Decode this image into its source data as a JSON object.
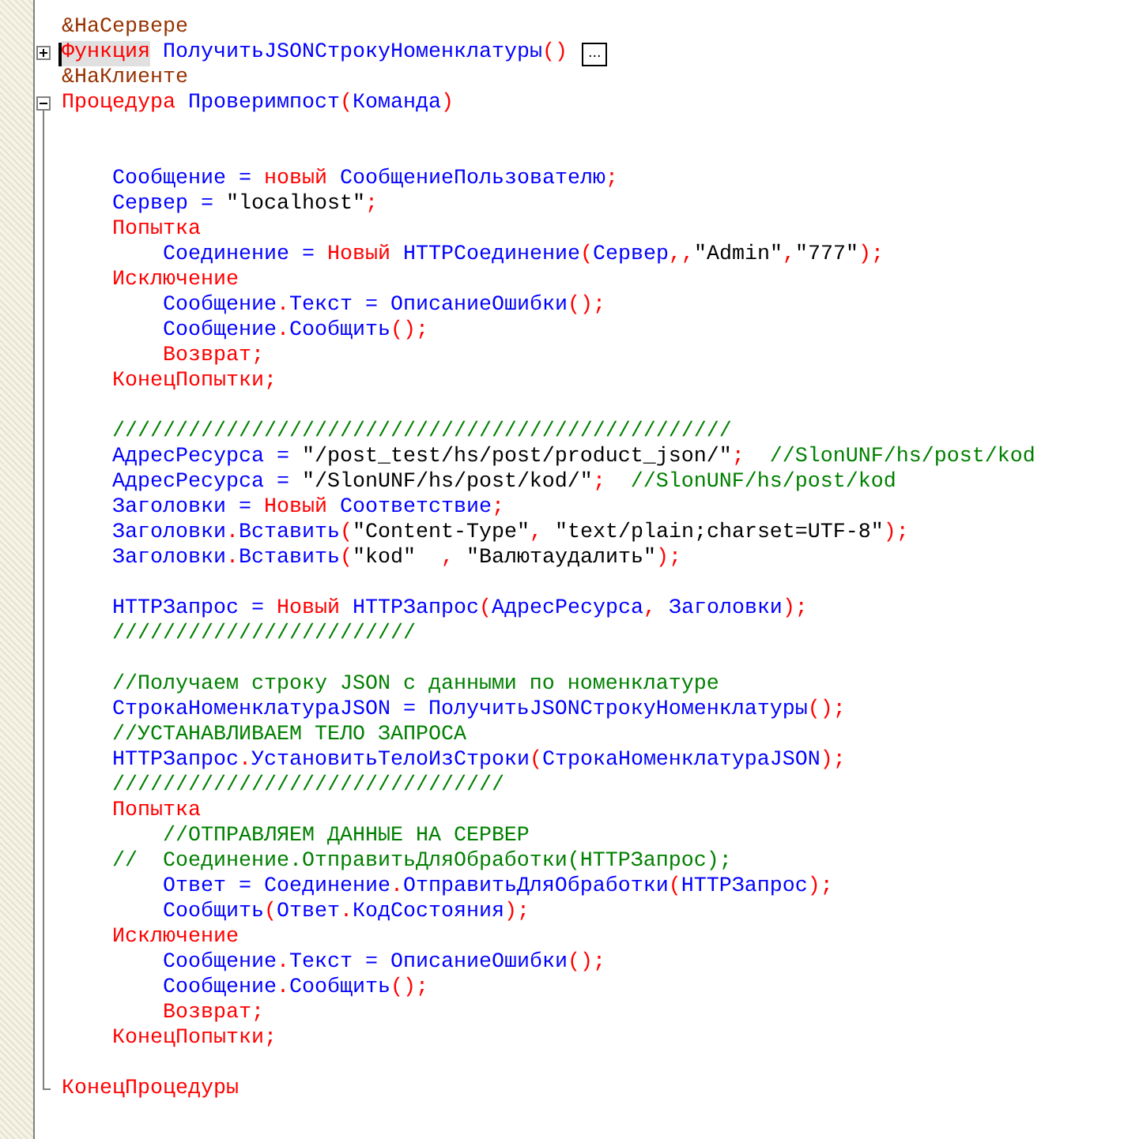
{
  "lines": [
    {
      "tokens": [
        {
          "kind": "dir",
          "text": "&НаСервере"
        }
      ]
    },
    {
      "kind": "fold_start",
      "expanded": false,
      "fold_label": "...",
      "cursor": true,
      "tokens": [
        {
          "kind": "kw",
          "text": "Функция",
          "highlight": true
        },
        {
          "kind": "id",
          "text": " ПолучитьJSONСтрокуНоменклатуры"
        },
        {
          "kind": "kw",
          "text": "()"
        }
      ]
    },
    {
      "tokens": [
        {
          "kind": "dir",
          "text": "&НаКлиенте"
        }
      ]
    },
    {
      "kind": "fold_start",
      "expanded": true,
      "tokens": [
        {
          "kind": "kw",
          "text": "Процедура"
        },
        {
          "kind": "id",
          "text": " Проверимпост"
        },
        {
          "kind": "kw",
          "text": "("
        },
        {
          "kind": "id",
          "text": "Команда"
        },
        {
          "kind": "kw",
          "text": ")"
        }
      ]
    },
    {
      "kind": "blank"
    },
    {
      "kind": "blank"
    },
    {
      "tokens": [
        {
          "kind": "id",
          "text": "    Сообщение = "
        },
        {
          "kind": "kw",
          "text": "новый"
        },
        {
          "kind": "id",
          "text": " СообщениеПользователю"
        },
        {
          "kind": "kw",
          "text": ";"
        }
      ]
    },
    {
      "tokens": [
        {
          "kind": "id",
          "text": "    Сервер = "
        },
        {
          "kind": "str",
          "text": "\"localhost\""
        },
        {
          "kind": "kw",
          "text": ";"
        }
      ]
    },
    {
      "tokens": [
        {
          "kind": "kw",
          "text": "    Попытка"
        }
      ]
    },
    {
      "tokens": [
        {
          "kind": "id",
          "text": "        Соединение = "
        },
        {
          "kind": "kw",
          "text": "Новый"
        },
        {
          "kind": "id",
          "text": " HTTPСоединение"
        },
        {
          "kind": "kw",
          "text": "("
        },
        {
          "kind": "id",
          "text": "Сервер"
        },
        {
          "kind": "kw",
          "text": ",,"
        },
        {
          "kind": "str",
          "text": "\"Admin\""
        },
        {
          "kind": "kw",
          "text": ","
        },
        {
          "kind": "str",
          "text": "\"777\""
        },
        {
          "kind": "kw",
          "text": ");"
        }
      ]
    },
    {
      "tokens": [
        {
          "kind": "kw",
          "text": "    Исключение"
        }
      ]
    },
    {
      "tokens": [
        {
          "kind": "id",
          "text": "        Сообщение",
          "sep": "."
        },
        {
          "kind": "id",
          "text": "Текст = ОписаниеОшибки"
        },
        {
          "kind": "kw",
          "text": "();"
        }
      ]
    },
    {
      "tokens": [
        {
          "kind": "id",
          "text": "        Сообщение",
          "sep": "."
        },
        {
          "kind": "id",
          "text": "Сообщить"
        },
        {
          "kind": "kw",
          "text": "();"
        }
      ]
    },
    {
      "tokens": [
        {
          "kind": "kw",
          "text": "        Возврат;"
        }
      ]
    },
    {
      "tokens": [
        {
          "kind": "kw",
          "text": "    КонецПопытки;"
        }
      ]
    },
    {
      "kind": "blank"
    },
    {
      "tokens": [
        {
          "kind": "com",
          "text": "    /////////////////////////////////////////////////"
        }
      ]
    },
    {
      "tokens": [
        {
          "kind": "id",
          "text": "    АдресРесурса = "
        },
        {
          "kind": "str",
          "text": "\"/post_test/hs/post/product_json/\""
        },
        {
          "kind": "kw",
          "text": ";"
        },
        {
          "kind": "com",
          "text": "  //SlonUNF/hs/post/kod"
        }
      ]
    },
    {
      "tokens": [
        {
          "kind": "id",
          "text": "    АдресРесурса = "
        },
        {
          "kind": "str",
          "text": "\"/SlonUNF/hs/post/kod/\""
        },
        {
          "kind": "kw",
          "text": ";"
        },
        {
          "kind": "com",
          "text": "  //SlonUNF/hs/post/kod"
        }
      ]
    },
    {
      "tokens": [
        {
          "kind": "id",
          "text": "    Заголовки = "
        },
        {
          "kind": "kw",
          "text": "Новый"
        },
        {
          "kind": "id",
          "text": " Соответствие"
        },
        {
          "kind": "kw",
          "text": ";"
        }
      ]
    },
    {
      "tokens": [
        {
          "kind": "id",
          "text": "    Заголовки"
        },
        {
          "kind": "kw",
          "text": "."
        },
        {
          "kind": "id",
          "text": "Вставить"
        },
        {
          "kind": "kw",
          "text": "("
        },
        {
          "kind": "str",
          "text": "\"Content-Type\""
        },
        {
          "kind": "kw",
          "text": ","
        },
        {
          "kind": "str",
          "text": " \"text/plain;charset=UTF-8\""
        },
        {
          "kind": "kw",
          "text": ");"
        }
      ]
    },
    {
      "tokens": [
        {
          "kind": "id",
          "text": "    Заголовки"
        },
        {
          "kind": "kw",
          "text": "."
        },
        {
          "kind": "id",
          "text": "Вставить"
        },
        {
          "kind": "kw",
          "text": "("
        },
        {
          "kind": "str",
          "text": "\"kod\"  "
        },
        {
          "kind": "kw",
          "text": ","
        },
        {
          "kind": "str",
          "text": " \"Валютаудалить\""
        },
        {
          "kind": "kw",
          "text": ");"
        }
      ]
    },
    {
      "kind": "blank"
    },
    {
      "tokens": [
        {
          "kind": "id",
          "text": "    HTTPЗапрос = "
        },
        {
          "kind": "kw",
          "text": "Новый"
        },
        {
          "kind": "id",
          "text": " HTTPЗапрос"
        },
        {
          "kind": "kw",
          "text": "("
        },
        {
          "kind": "id",
          "text": "АдресРесурса"
        },
        {
          "kind": "kw",
          "text": ","
        },
        {
          "kind": "id",
          "text": " Заголовки"
        },
        {
          "kind": "kw",
          "text": ");"
        }
      ]
    },
    {
      "tokens": [
        {
          "kind": "com",
          "text": "    ////////////////////////"
        }
      ]
    },
    {
      "kind": "blank"
    },
    {
      "tokens": [
        {
          "kind": "com",
          "text": "    //Получаем строку JSON с данными по номенклатуре"
        }
      ]
    },
    {
      "tokens": [
        {
          "kind": "id",
          "text": "    СтрокаНоменклатураJSON = ПолучитьJSONСтрокуНоменклатуры"
        },
        {
          "kind": "kw",
          "text": "();"
        }
      ]
    },
    {
      "tokens": [
        {
          "kind": "com",
          "text": "    //УСТАНАВЛИВАЕМ ТЕЛО ЗАПРОСА"
        }
      ]
    },
    {
      "tokens": [
        {
          "kind": "id",
          "text": "    HTTPЗапрос"
        },
        {
          "kind": "kw",
          "text": "."
        },
        {
          "kind": "id",
          "text": "УстановитьТелоИзСтроки"
        },
        {
          "kind": "kw",
          "text": "("
        },
        {
          "kind": "id",
          "text": "СтрокаНоменклатураJSON"
        },
        {
          "kind": "kw",
          "text": ");"
        }
      ]
    },
    {
      "tokens": [
        {
          "kind": "com",
          "text": "    ///////////////////////////////"
        }
      ]
    },
    {
      "tokens": [
        {
          "kind": "kw",
          "text": "    Попытка"
        }
      ]
    },
    {
      "tokens": [
        {
          "kind": "com",
          "text": "        //ОТПРАВЛЯЕМ ДАННЫЕ НА СЕРВЕР"
        }
      ]
    },
    {
      "tokens": [
        {
          "kind": "com",
          "text": "    //  Соединение.ОтправитьДляОбработки(HTTPЗапрос);"
        }
      ]
    },
    {
      "tokens": [
        {
          "kind": "id",
          "text": "        Ответ = Соединение"
        },
        {
          "kind": "kw",
          "text": "."
        },
        {
          "kind": "id",
          "text": "ОтправитьДляОбработки"
        },
        {
          "kind": "kw",
          "text": "("
        },
        {
          "kind": "id",
          "text": "HTTPЗапрос"
        },
        {
          "kind": "kw",
          "text": ");"
        }
      ]
    },
    {
      "tokens": [
        {
          "kind": "id",
          "text": "        Сообщить"
        },
        {
          "kind": "kw",
          "text": "("
        },
        {
          "kind": "id",
          "text": "Ответ"
        },
        {
          "kind": "kw",
          "text": "."
        },
        {
          "kind": "id",
          "text": "КодСостояния"
        },
        {
          "kind": "kw",
          "text": ");"
        }
      ]
    },
    {
      "tokens": [
        {
          "kind": "kw",
          "text": "    Исключение"
        }
      ]
    },
    {
      "tokens": [
        {
          "kind": "id",
          "text": "        Сообщение",
          "sep": "."
        },
        {
          "kind": "id",
          "text": "Текст = ОписаниеОшибки"
        },
        {
          "kind": "kw",
          "text": "();"
        }
      ]
    },
    {
      "tokens": [
        {
          "kind": "id",
          "text": "        Сообщение",
          "sep": "."
        },
        {
          "kind": "id",
          "text": "Сообщить"
        },
        {
          "kind": "kw",
          "text": "();"
        }
      ]
    },
    {
      "tokens": [
        {
          "kind": "kw",
          "text": "        Возврат;"
        }
      ]
    },
    {
      "tokens": [
        {
          "kind": "kw",
          "text": "    КонецПопытки;"
        }
      ]
    },
    {
      "kind": "blank"
    },
    {
      "kind": "fold_end",
      "tokens": [
        {
          "kind": "kw",
          "text": "КонецПроцедуры"
        }
      ]
    }
  ]
}
